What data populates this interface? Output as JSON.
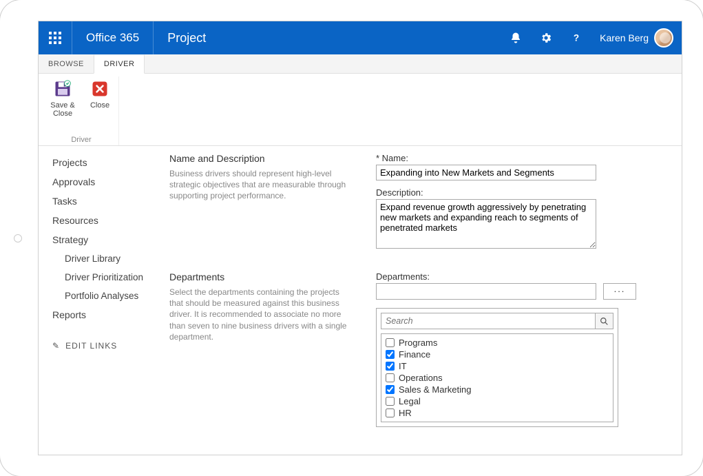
{
  "header": {
    "brand": "Office 365",
    "app": "Project",
    "user_name": "Karen Berg"
  },
  "tabs": {
    "browse": "BROWSE",
    "driver": "DRIVER"
  },
  "ribbon": {
    "save_close": "Save & Close",
    "close": "Close",
    "group_label": "Driver"
  },
  "nav": {
    "projects": "Projects",
    "approvals": "Approvals",
    "tasks": "Tasks",
    "resources": "Resources",
    "strategy": "Strategy",
    "driver_library": "Driver Library",
    "driver_prioritization": "Driver Prioritization",
    "portfolio_analyses": "Portfolio Analyses",
    "reports": "Reports",
    "edit_links": "EDIT LINKS"
  },
  "section_name": {
    "title": "Name and Description",
    "desc": "Business drivers should represent high-level strategic objectives that are measurable through supporting project performance.",
    "name_label": "Name:",
    "name_value": "Expanding into New Markets and Segments",
    "description_label": "Description:",
    "description_value": "Expand revenue growth aggressively by penetrating new markets and expanding reach to segments of penetrated markets"
  },
  "section_dept": {
    "title": "Departments",
    "desc": "Select the departments containing the projects that should be measured against this business driver. It is recommended to associate no more than seven to nine business drivers with a single department.",
    "field_label": "Departments:",
    "search_placeholder": "Search",
    "browse_label": "...",
    "items": [
      {
        "label": "Programs",
        "checked": false
      },
      {
        "label": "Finance",
        "checked": true
      },
      {
        "label": "IT",
        "checked": true
      },
      {
        "label": "Operations",
        "checked": false
      },
      {
        "label": "Sales & Marketing",
        "checked": true
      },
      {
        "label": "Legal",
        "checked": false
      },
      {
        "label": "HR",
        "checked": false
      }
    ]
  }
}
